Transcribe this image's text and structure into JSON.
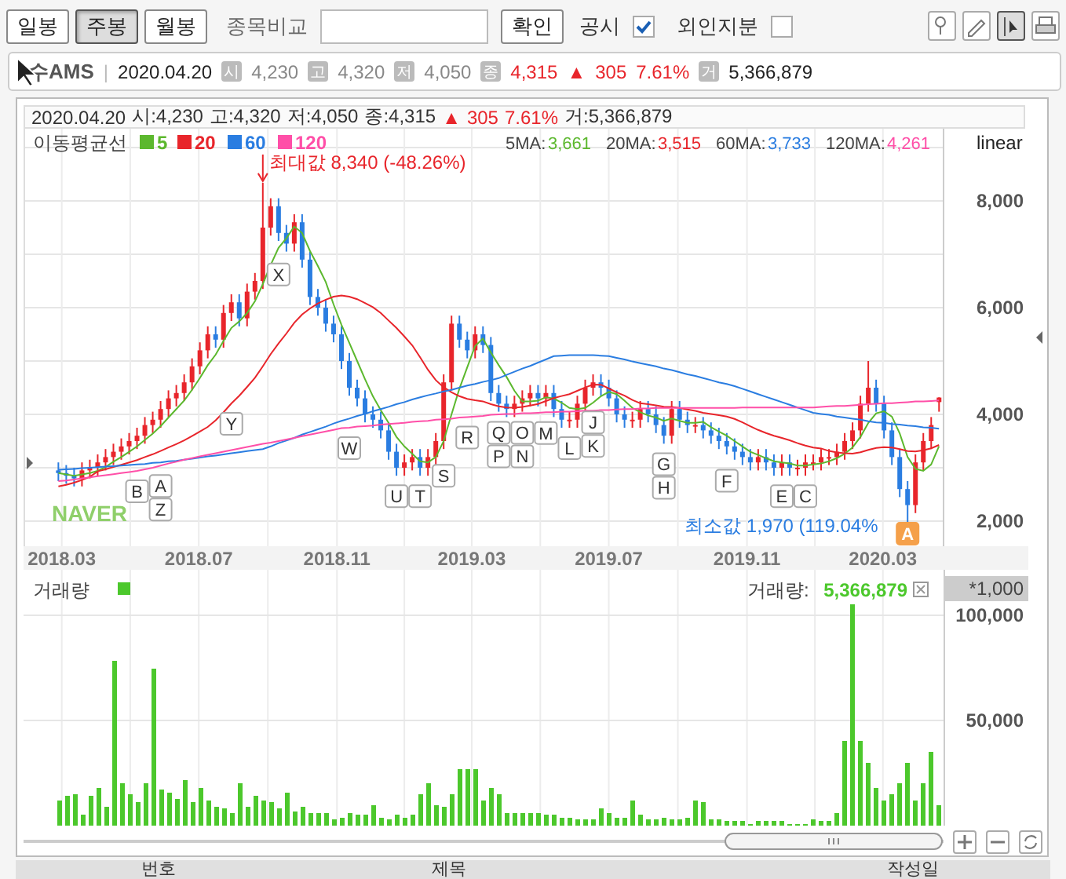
{
  "toolbar": {
    "period_tabs": [
      {
        "label": "일봉",
        "selected": false
      },
      {
        "label": "주봉",
        "selected": true
      },
      {
        "label": "월봉",
        "selected": false
      }
    ],
    "compare_label": "종목비교",
    "confirm_button": "확인",
    "checks": [
      {
        "label": "공시",
        "checked": true
      },
      {
        "label": "외인지분",
        "checked": false
      }
    ],
    "tools": [
      {
        "kind": "pin",
        "selected": false
      },
      {
        "kind": "pencil",
        "selected": false
      },
      {
        "kind": "cursor",
        "selected": true
      },
      {
        "kind": "print",
        "selected": false
      }
    ]
  },
  "info_bar": {
    "name": "수AMS",
    "separator": "|",
    "date": "2020.04.20",
    "fields": [
      {
        "tag": "시",
        "value": "4,230",
        "kind": "plain"
      },
      {
        "tag": "고",
        "value": "4,320",
        "kind": "plain"
      },
      {
        "tag": "저",
        "value": "4,050",
        "kind": "plain"
      },
      {
        "tag": "종",
        "value": "4,315",
        "kind": "change",
        "arrow": "▲",
        "change": "305",
        "rate": "7.61%"
      },
      {
        "tag": "거",
        "value": "5,366,879",
        "kind": "volume"
      }
    ]
  },
  "price_chart": {
    "info_line": [
      {
        "text": "2020.04.20",
        "kind": "plain"
      },
      {
        "text": "시:4,230",
        "kind": "plain"
      },
      {
        "text": "고:4,320",
        "kind": "plain"
      },
      {
        "text": "저:4,050",
        "kind": "plain"
      },
      {
        "text": "종:4,315",
        "kind": "plain"
      },
      {
        "text": "▲",
        "kind": "up"
      },
      {
        "text": "305",
        "kind": "up"
      },
      {
        "text": "7.61%",
        "kind": "up"
      },
      {
        "text": "거:5,366,879",
        "kind": "plain"
      }
    ],
    "ma_title": "이동평균선",
    "scale": "linear",
    "logo": "NAVER",
    "ma_readings": [
      {
        "label": "5MA:",
        "value": "3,661",
        "color": "#5cb82e"
      },
      {
        "label": "20MA:",
        "value": "3,515",
        "color": "#e8252b"
      },
      {
        "label": "60MA:",
        "value": "3,733",
        "color": "#2a7de1"
      },
      {
        "label": "120MA:",
        "value": "4,261",
        "color": "#ff4fa8"
      }
    ],
    "chart_data": {
      "type": "candlestick",
      "legend": "top left",
      "grid": true,
      "x": [
        "2018-02-26",
        "2018-03-05",
        "2018-03-12",
        "2018-03-19",
        "2018-03-26",
        "2018-04-02",
        "2018-04-09",
        "2018-04-16",
        "2018-04-23",
        "2018-04-30",
        "2018-05-07",
        "2018-05-14",
        "2018-05-21",
        "2018-05-28",
        "2018-06-04",
        "2018-06-11",
        "2018-06-18",
        "2018-06-25",
        "2018-07-02",
        "2018-07-09",
        "2018-07-16",
        "2018-07-23",
        "2018-07-30",
        "2018-08-06",
        "2018-08-13",
        "2018-08-20",
        "2018-08-27",
        "2018-09-03",
        "2018-09-10",
        "2018-09-17",
        "2018-09-24",
        "2018-10-01",
        "2018-10-08",
        "2018-10-15",
        "2018-10-22",
        "2018-10-29",
        "2018-11-05",
        "2018-11-12",
        "2018-11-19",
        "2018-11-26",
        "2018-12-03",
        "2018-12-10",
        "2018-12-17",
        "2018-12-24",
        "2018-12-31",
        "2019-01-07",
        "2019-01-14",
        "2019-01-21",
        "2019-01-28",
        "2019-02-04",
        "2019-02-11",
        "2019-02-18",
        "2019-02-25",
        "2019-03-04",
        "2019-03-11",
        "2019-03-18",
        "2019-03-25",
        "2019-04-01",
        "2019-04-08",
        "2019-04-15",
        "2019-04-22",
        "2019-04-29",
        "2019-05-06",
        "2019-05-13",
        "2019-05-20",
        "2019-05-27",
        "2019-06-03",
        "2019-06-10",
        "2019-06-17",
        "2019-06-24",
        "2019-07-01",
        "2019-07-08",
        "2019-07-15",
        "2019-07-22",
        "2019-07-29",
        "2019-08-05",
        "2019-08-12",
        "2019-08-19",
        "2019-08-26",
        "2019-09-02",
        "2019-09-09",
        "2019-09-16",
        "2019-09-23",
        "2019-09-30",
        "2019-10-07",
        "2019-10-14",
        "2019-10-21",
        "2019-10-28",
        "2019-11-04",
        "2019-11-11",
        "2019-11-18",
        "2019-11-25",
        "2019-12-02",
        "2019-12-09",
        "2019-12-16",
        "2019-12-23",
        "2019-12-30",
        "2020-01-06",
        "2020-01-13",
        "2020-01-20",
        "2020-01-27",
        "2020-02-03",
        "2020-02-10",
        "2020-02-17",
        "2020-02-24",
        "2020-03-02",
        "2020-03-09",
        "2020-03-16",
        "2020-03-23",
        "2020-03-30",
        "2020-04-06",
        "2020-04-13",
        "2020-04-20"
      ],
      "ohlc": [
        [
          2950,
          3100,
          2750,
          2900
        ],
        [
          2900,
          3050,
          2700,
          2850
        ],
        [
          2850,
          3000,
          2650,
          2800
        ],
        [
          2800,
          3100,
          2650,
          2950
        ],
        [
          2950,
          3150,
          2800,
          3000
        ],
        [
          3000,
          3250,
          2850,
          3100
        ],
        [
          3100,
          3350,
          2950,
          3200
        ],
        [
          3200,
          3450,
          3050,
          3300
        ],
        [
          3300,
          3550,
          3150,
          3400
        ],
        [
          3400,
          3650,
          3250,
          3500
        ],
        [
          3500,
          3750,
          3350,
          3600
        ],
        [
          3600,
          3950,
          3450,
          3800
        ],
        [
          3800,
          4050,
          3650,
          3900
        ],
        [
          3900,
          4250,
          3750,
          4100
        ],
        [
          4100,
          4450,
          3950,
          4300
        ],
        [
          4300,
          4550,
          4150,
          4400
        ],
        [
          4400,
          4750,
          4250,
          4600
        ],
        [
          4600,
          5050,
          4450,
          4900
        ],
        [
          4900,
          5350,
          4750,
          5200
        ],
        [
          5200,
          5650,
          5050,
          5500
        ],
        [
          5500,
          5650,
          5250,
          5400
        ],
        [
          5400,
          6050,
          5250,
          5900
        ],
        [
          5900,
          6250,
          5750,
          6100
        ],
        [
          6100,
          6250,
          5650,
          5800
        ],
        [
          5800,
          6450,
          5650,
          6300
        ],
        [
          6300,
          6650,
          6150,
          6500
        ],
        [
          6500,
          8340,
          6350,
          7500
        ],
        [
          7500,
          8050,
          7350,
          7900
        ],
        [
          7900,
          8050,
          7250,
          7400
        ],
        [
          7400,
          7550,
          7050,
          7200
        ],
        [
          7200,
          7750,
          7050,
          7600
        ],
        [
          7600,
          7750,
          6750,
          6900
        ],
        [
          6900,
          7050,
          6050,
          6200
        ],
        [
          6200,
          6350,
          5850,
          6000
        ],
        [
          6000,
          6150,
          5550,
          5700
        ],
        [
          5700,
          5850,
          5350,
          5500
        ],
        [
          5500,
          5650,
          4850,
          5000
        ],
        [
          5000,
          5150,
          4350,
          4500
        ],
        [
          4500,
          4650,
          4150,
          4300
        ],
        [
          4300,
          4450,
          3850,
          4000
        ],
        [
          4000,
          4150,
          3750,
          3900
        ],
        [
          3900,
          4050,
          3550,
          3700
        ],
        [
          3700,
          3850,
          3150,
          3300
        ],
        [
          3300,
          3450,
          2850,
          3000
        ],
        [
          3000,
          3250,
          2850,
          3100
        ],
        [
          3100,
          3350,
          2950,
          3200
        ],
        [
          3200,
          3350,
          2850,
          3000
        ],
        [
          3000,
          3350,
          2850,
          3200
        ],
        [
          3200,
          3650,
          3050,
          3500
        ],
        [
          3500,
          4750,
          3350,
          4600
        ],
        [
          4600,
          5850,
          4450,
          5700
        ],
        [
          5700,
          5850,
          5250,
          5400
        ],
        [
          5400,
          5550,
          5050,
          5200
        ],
        [
          5200,
          5650,
          5050,
          5500
        ],
        [
          5500,
          5650,
          5150,
          5300
        ],
        [
          5300,
          5450,
          4250,
          4400
        ],
        [
          4400,
          4550,
          4050,
          4200
        ],
        [
          4200,
          4350,
          3950,
          4100
        ],
        [
          4100,
          4350,
          3950,
          4200
        ],
        [
          4200,
          4450,
          4050,
          4300
        ],
        [
          4300,
          4550,
          4150,
          4400
        ],
        [
          4400,
          4550,
          4150,
          4300
        ],
        [
          4300,
          4550,
          4150,
          4400
        ],
        [
          4400,
          4550,
          3950,
          4100
        ],
        [
          4100,
          4250,
          3750,
          3900
        ],
        [
          3900,
          4050,
          3750,
          3900
        ],
        [
          3900,
          4350,
          3750,
          4200
        ],
        [
          4200,
          4650,
          4050,
          4500
        ],
        [
          4500,
          4750,
          4350,
          4600
        ],
        [
          4600,
          4750,
          4350,
          4500
        ],
        [
          4500,
          4650,
          4150,
          4300
        ],
        [
          4300,
          4450,
          3850,
          4000
        ],
        [
          4000,
          4150,
          3750,
          3900
        ],
        [
          3900,
          4050,
          3750,
          3900
        ],
        [
          3900,
          4250,
          3750,
          4100
        ],
        [
          4100,
          4250,
          3850,
          4000
        ],
        [
          4000,
          4150,
          3650,
          3800
        ],
        [
          3800,
          3950,
          3450,
          3600
        ],
        [
          3600,
          4250,
          3450,
          4100
        ],
        [
          4100,
          4250,
          3750,
          3900
        ],
        [
          3900,
          4050,
          3650,
          3800
        ],
        [
          3800,
          3950,
          3650,
          3800
        ],
        [
          3800,
          3950,
          3550,
          3700
        ],
        [
          3700,
          3850,
          3450,
          3600
        ],
        [
          3600,
          3750,
          3350,
          3500
        ],
        [
          3500,
          3650,
          3250,
          3400
        ],
        [
          3400,
          3550,
          3150,
          3300
        ],
        [
          3300,
          3450,
          3050,
          3200
        ],
        [
          3200,
          3350,
          2950,
          3100
        ],
        [
          3100,
          3350,
          2950,
          3200
        ],
        [
          3200,
          3350,
          2950,
          3100
        ],
        [
          3100,
          3250,
          2850,
          3000
        ],
        [
          3000,
          3250,
          2850,
          3100
        ],
        [
          3100,
          3250,
          2850,
          3000
        ],
        [
          3000,
          3150,
          2850,
          3000
        ],
        [
          3000,
          3250,
          2850,
          3100
        ],
        [
          3100,
          3250,
          2950,
          3100
        ],
        [
          3100,
          3350,
          2950,
          3200
        ],
        [
          3200,
          3350,
          3050,
          3200
        ],
        [
          3200,
          3450,
          3050,
          3300
        ],
        [
          3300,
          3650,
          3150,
          3500
        ],
        [
          3500,
          3850,
          3350,
          3700
        ],
        [
          3700,
          4350,
          3550,
          4200
        ],
        [
          4200,
          5000,
          4050,
          4500
        ],
        [
          4500,
          4650,
          4050,
          4200
        ],
        [
          4200,
          4350,
          3550,
          3700
        ],
        [
          3700,
          3850,
          3050,
          3200
        ],
        [
          3200,
          3350,
          2450,
          2600
        ],
        [
          2600,
          2750,
          1970,
          2300
        ],
        [
          2300,
          3250,
          2150,
          3100
        ],
        [
          3100,
          3650,
          2950,
          3500
        ],
        [
          3500,
          3950,
          3350,
          3800
        ],
        [
          4230,
          4320,
          4050,
          4315
        ]
      ],
      "series": [
        {
          "name": "5",
          "type": "line",
          "color": "#5cb82e",
          "values": [
            2900,
            2875,
            2850,
            2875,
            2900,
            2940,
            3010,
            3110,
            3200,
            3300,
            3400,
            3520,
            3640,
            3780,
            3940,
            4100,
            4260,
            4460,
            4680,
            4920,
            5120,
            5380,
            5620,
            5740,
            5900,
            6120,
            6440,
            6800,
            7120,
            7300,
            7520,
            7400,
            7060,
            6780,
            6480,
            6060,
            5680,
            5340,
            5000,
            4660,
            4340,
            4080,
            3840,
            3580,
            3400,
            3260,
            3120,
            3100,
            3200,
            3500,
            4000,
            4480,
            4880,
            5280,
            5420,
            5160,
            4920,
            4700,
            4440,
            4240,
            4240,
            4260,
            4320,
            4300,
            4220,
            4120,
            4100,
            4120,
            4220,
            4340,
            4420,
            4380,
            4260,
            4120,
            4040,
            3980,
            3940,
            3880,
            3920,
            3880,
            3840,
            3840,
            3860,
            3760,
            3680,
            3600,
            3500,
            3400,
            3300,
            3240,
            3180,
            3120,
            3100,
            3080,
            3040,
            3040,
            3060,
            3080,
            3120,
            3180,
            3260,
            3380,
            3580,
            3840,
            4020,
            4060,
            3960,
            3640,
            3200,
            2980,
            2940,
            3060,
            3403
          ]
        },
        {
          "name": "20",
          "type": "line",
          "color": "#e8252b",
          "values": [
            2650,
            2680,
            2720,
            2770,
            2830,
            2933,
            2971,
            3013,
            3056,
            3100,
            3145,
            3200,
            3254,
            3314,
            3380,
            3444,
            3512,
            3594,
            3679,
            3765,
            3890,
            4042,
            4207,
            4350,
            4515,
            4685,
            4900,
            5130,
            5330,
            5515,
            5715,
            5870,
            5985,
            6080,
            6150,
            6205,
            6225,
            6205,
            6160,
            6085,
            6010,
            5900,
            5760,
            5620,
            5460,
            5295,
            5070,
            4835,
            4640,
            4510,
            4415,
            4340,
            4290,
            4265,
            4245,
            4190,
            4150,
            4130,
            4125,
            4140,
            4165,
            4195,
            4250,
            4305,
            4345,
            4380,
            4440,
            4505,
            4560,
            4555,
            4485,
            4415,
            4350,
            4270,
            4210,
            4190,
            4170,
            4145,
            4140,
            4120,
            4090,
            4065,
            4030,
            4005,
            3985,
            3960,
            3915,
            3850,
            3775,
            3710,
            3650,
            3600,
            3560,
            3515,
            3460,
            3415,
            3380,
            3360,
            3315,
            3285,
            3270,
            3265,
            3290,
            3335,
            3370,
            3385,
            3380,
            3350,
            3310,
            3305,
            3325,
            3365,
            3426
          ]
        },
        {
          "name": "60",
          "type": "line",
          "color": "#2a7de1",
          "values": [
            2960,
            2970,
            2980,
            2990,
            3000,
            3010,
            3020,
            3030,
            3040,
            3050,
            3060,
            3070,
            3090,
            3100,
            3120,
            3130,
            3150,
            3170,
            3190,
            3210,
            3230,
            3250,
            3270,
            3290,
            3310,
            3330,
            3350,
            3400,
            3460,
            3510,
            3560,
            3620,
            3670,
            3720,
            3770,
            3830,
            3880,
            3920,
            3970,
            4010,
            4060,
            4100,
            4140,
            4190,
            4230,
            4280,
            4320,
            4360,
            4390,
            4430,
            4460,
            4500,
            4540,
            4570,
            4610,
            4640,
            4680,
            4740,
            4800,
            4860,
            4910,
            4970,
            5030,
            5090,
            5100,
            5110,
            5110,
            5110,
            5110,
            5100,
            5090,
            5060,
            5030,
            4990,
            4960,
            4930,
            4900,
            4860,
            4830,
            4790,
            4750,
            4720,
            4680,
            4640,
            4600,
            4570,
            4530,
            4480,
            4430,
            4380,
            4330,
            4280,
            4230,
            4180,
            4130,
            4080,
            4030,
            4010,
            3990,
            3960,
            3940,
            3920,
            3900,
            3870,
            3850,
            3840,
            3820,
            3810,
            3790,
            3780,
            3760,
            3750,
            3733
          ]
        },
        {
          "name": "120",
          "type": "line",
          "color": "#ff4fa8",
          "values": [
            2750,
            2760,
            2780,
            2800,
            2820,
            2840,
            2860,
            2880,
            2900,
            2920,
            2940,
            2970,
            3000,
            3040,
            3080,
            3110,
            3150,
            3180,
            3210,
            3240,
            3270,
            3300,
            3330,
            3360,
            3390,
            3420,
            3450,
            3470,
            3500,
            3530,
            3560,
            3590,
            3620,
            3650,
            3680,
            3710,
            3740,
            3750,
            3770,
            3780,
            3790,
            3810,
            3820,
            3830,
            3840,
            3860,
            3870,
            3880,
            3900,
            3910,
            3920,
            3940,
            3950,
            3960,
            3970,
            3990,
            4000,
            4010,
            4010,
            4020,
            4020,
            4030,
            4040,
            4040,
            4050,
            4050,
            4060,
            4070,
            4070,
            4080,
            4080,
            4090,
            4100,
            4100,
            4110,
            4110,
            4120,
            4120,
            4120,
            4120,
            4120,
            4120,
            4120,
            4120,
            4120,
            4120,
            4120,
            4130,
            4130,
            4130,
            4130,
            4130,
            4130,
            4130,
            4130,
            4130,
            4130,
            4140,
            4150,
            4160,
            4160,
            4170,
            4180,
            4190,
            4200,
            4210,
            4210,
            4220,
            4230,
            4240,
            4240,
            4250,
            4261
          ]
        }
      ],
      "xlim": [
        "2018-01-26",
        "2020-04-24"
      ],
      "ylim": [
        1529,
        9353
      ],
      "xticks": [
        {
          "value": "2018-03-01",
          "label": "2018.03"
        },
        {
          "value": "2018-07-01",
          "label": "2018.07"
        },
        {
          "value": "2018-11-01",
          "label": "2018.11"
        },
        {
          "value": "2019-03-01",
          "label": "2019.03"
        },
        {
          "value": "2019-07-01",
          "label": "2019.07"
        },
        {
          "value": "2019-11-01",
          "label": "2019.11"
        },
        {
          "value": "2020-03-01",
          "label": "2020.03"
        }
      ],
      "yticks": [
        {
          "value": 2000,
          "label": "2,000"
        },
        {
          "value": 4000,
          "label": "4,000"
        },
        {
          "value": 6000,
          "label": "6,000"
        },
        {
          "value": 8000,
          "label": "8,000"
        }
      ],
      "annotations": [
        {
          "text": "최대값 8,340 (-48.26%)",
          "x": "2018-08-27",
          "y": 8340
        },
        {
          "text": "최소값 1,970 (119.04%",
          "x": "2020-03-23",
          "y": 1970
        },
        {
          "text": "B",
          "x": "2018-05-07",
          "y": 2940
        },
        {
          "text": "A",
          "x": "2018-05-28",
          "y": 3040
        },
        {
          "text": "Z",
          "x": "2018-05-28",
          "y": 3040
        },
        {
          "text": "Y",
          "x": "2018-07-30",
          "y": 4207
        },
        {
          "text": "X",
          "x": "2018-09-10",
          "y": 7120
        },
        {
          "text": "W",
          "x": "2018-11-12",
          "y": 3750
        },
        {
          "text": "U",
          "x": "2018-12-24",
          "y": 2850
        },
        {
          "text": "T",
          "x": "2019-01-14",
          "y": 2850
        },
        {
          "text": "S",
          "x": "2019-02-04",
          "y": 3350
        },
        {
          "text": "R",
          "x": "2019-02-25",
          "y": 3950
        },
        {
          "text": "Q",
          "x": "2019-03-25",
          "y": 4050
        },
        {
          "text": "P",
          "x": "2019-03-25",
          "y": 4050
        },
        {
          "text": "O",
          "x": "2019-04-15",
          "y": 4050
        },
        {
          "text": "N",
          "x": "2019-04-15",
          "y": 4050
        },
        {
          "text": "M",
          "x": "2019-05-06",
          "y": 4150
        },
        {
          "text": "L",
          "x": "2019-05-27",
          "y": 3750
        },
        {
          "text": "J",
          "x": "2019-06-17",
          "y": 4350
        },
        {
          "text": "K",
          "x": "2019-06-17",
          "y": 4350
        },
        {
          "text": "G",
          "x": "2019-08-19",
          "y": 3450
        },
        {
          "text": "H",
          "x": "2019-08-19",
          "y": 3450
        },
        {
          "text": "F",
          "x": "2019-10-14",
          "y": 3250
        },
        {
          "text": "E",
          "x": "2019-12-02",
          "y": 2850
        },
        {
          "text": "C",
          "x": "2019-12-23",
          "y": 2850
        },
        {
          "text": "A",
          "x": "2020-03-23",
          "y": 1970
        }
      ]
    }
  },
  "volume_chart": {
    "reading_label": "거래량:",
    "reading": "5,366,879",
    "unit": "*1,000",
    "chart_data": {
      "type": "bar",
      "grid": true,
      "ylim": [
        0,
        121642
      ],
      "yticks": [
        {
          "value": 50000,
          "label": "50,000"
        },
        {
          "value": 100000,
          "label": "100,000"
        }
      ],
      "series": [
        {
          "name": "거래량",
          "color": "#4cc82c",
          "values": [
            null,
            null,
            null,
            null,
            12000,
            14000,
            15000,
            5000,
            14000,
            18000,
            9000,
            78000,
            20000,
            15000,
            11000,
            20000,
            75000,
            17000,
            16000,
            13000,
            22000,
            11000,
            18000,
            12000,
            9000,
            8000,
            6000,
            20000,
            9000,
            14000,
            12000,
            11000,
            8000,
            16000,
            7000,
            9000,
            6000,
            6000,
            6000,
            3000,
            4000,
            6000,
            5000,
            5000,
            10000,
            4000,
            3000,
            5000,
            4000,
            5000,
            15000,
            20000,
            10000,
            9000,
            15000,
            27000,
            27000,
            27000,
            12000,
            18000,
            15000,
            6000,
            6000,
            6000,
            6000,
            6000,
            5000,
            5000,
            4000,
            4000,
            3000,
            3000,
            3000,
            8000,
            6000,
            4000,
            4000,
            12000,
            5000,
            3000,
            3000,
            4000,
            3000,
            3000,
            4000,
            12000,
            11000,
            3000,
            3000,
            2000,
            2000,
            2000,
            1000,
            2000,
            2000,
            2000,
            2000,
            1000,
            1000,
            1000,
            3000,
            2000,
            2000,
            6000,
            40000,
            105000,
            40000,
            30000,
            18000,
            12000,
            15000,
            20000,
            30000,
            12000,
            20000,
            35000,
            10000
          ]
        }
      ]
    }
  },
  "board_columns": [
    "번호",
    "제목",
    "작성일"
  ]
}
